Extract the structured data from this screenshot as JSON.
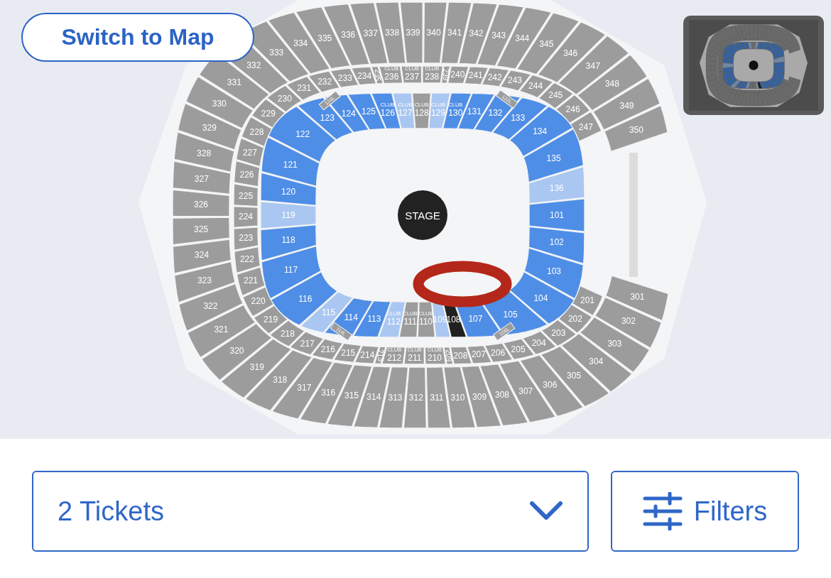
{
  "map_toggle": {
    "label": "Switch to Map"
  },
  "stage": {
    "label": "STAGE"
  },
  "map": {
    "upper_level": {
      "top": [
        {
          "label": "333",
          "color": "#9c9c9c"
        },
        {
          "label": "334",
          "color": "#9c9c9c"
        },
        {
          "label": "335",
          "color": "#9c9c9c"
        },
        {
          "label": "336",
          "color": "#9c9c9c"
        },
        {
          "label": "337",
          "color": "#9c9c9c"
        },
        {
          "label": "338",
          "color": "#9c9c9c"
        },
        {
          "label": "339",
          "color": "#9c9c9c"
        },
        {
          "label": "340",
          "color": "#9c9c9c"
        },
        {
          "label": "341",
          "color": "#9c9c9c"
        },
        {
          "label": "342",
          "color": "#9c9c9c"
        },
        {
          "label": "343",
          "color": "#9c9c9c"
        },
        {
          "label": "344",
          "color": "#9c9c9c"
        },
        {
          "label": "345",
          "color": "#9c9c9c"
        },
        {
          "label": "346",
          "color": "#9c9c9c"
        }
      ],
      "left": [
        {
          "label": "332",
          "color": "#9c9c9c"
        },
        {
          "label": "331",
          "color": "#9c9c9c"
        },
        {
          "label": "330",
          "color": "#9c9c9c"
        },
        {
          "label": "329",
          "color": "#9c9c9c"
        },
        {
          "label": "328",
          "color": "#9c9c9c"
        },
        {
          "label": "327",
          "color": "#9c9c9c"
        },
        {
          "label": "326",
          "color": "#9c9c9c"
        },
        {
          "label": "325",
          "color": "#9c9c9c"
        },
        {
          "label": "324",
          "color": "#9c9c9c"
        },
        {
          "label": "323",
          "color": "#9c9c9c"
        },
        {
          "label": "322",
          "color": "#9c9c9c"
        },
        {
          "label": "321",
          "color": "#9c9c9c"
        },
        {
          "label": "320",
          "color": "#9c9c9c"
        },
        {
          "label": "319",
          "color": "#9c9c9c"
        }
      ],
      "right": [
        {
          "label": "347",
          "color": "#9c9c9c"
        },
        {
          "label": "348",
          "color": "#9c9c9c"
        },
        {
          "label": "349",
          "color": "#9c9c9c"
        },
        {
          "label": "350",
          "color": "#9c9c9c"
        },
        {
          "label": "301",
          "color": "#9c9c9c"
        },
        {
          "label": "302",
          "color": "#9c9c9c"
        },
        {
          "label": "303",
          "color": "#9c9c9c"
        },
        {
          "label": "304",
          "color": "#9c9c9c"
        }
      ],
      "bottom": [
        {
          "label": "318",
          "color": "#9c9c9c"
        },
        {
          "label": "317",
          "color": "#9c9c9c"
        },
        {
          "label": "316",
          "color": "#9c9c9c"
        },
        {
          "label": "315",
          "color": "#9c9c9c"
        },
        {
          "label": "314",
          "color": "#9c9c9c"
        },
        {
          "label": "313",
          "color": "#9c9c9c"
        },
        {
          "label": "312",
          "color": "#9c9c9c"
        },
        {
          "label": "311",
          "color": "#9c9c9c"
        },
        {
          "label": "310",
          "color": "#9c9c9c"
        },
        {
          "label": "309",
          "color": "#9c9c9c"
        },
        {
          "label": "308",
          "color": "#9c9c9c"
        },
        {
          "label": "307",
          "color": "#9c9c9c"
        },
        {
          "label": "306",
          "color": "#9c9c9c"
        },
        {
          "label": "305",
          "color": "#9c9c9c"
        }
      ]
    },
    "club_level": {
      "top": [
        {
          "label": "231",
          "kind": "standard",
          "color": "#9c9c9c"
        },
        {
          "label": "232",
          "kind": "standard",
          "color": "#9c9c9c"
        },
        {
          "label": "233",
          "kind": "standard",
          "color": "#9c9c9c"
        },
        {
          "label": "234",
          "kind": "standard",
          "color": "#9c9c9c"
        },
        {
          "label": "235",
          "kind": "narrow",
          "color": "#9c9c9c"
        },
        {
          "label": "236",
          "kind": "club",
          "tag": "CLUB",
          "color": "#9c9c9c"
        },
        {
          "label": "237",
          "kind": "club",
          "tag": "CLUB",
          "color": "#9c9c9c"
        },
        {
          "label": "238",
          "kind": "club",
          "tag": "CLUB",
          "color": "#9c9c9c"
        },
        {
          "label": "239",
          "kind": "narrow",
          "color": "#9c9c9c"
        },
        {
          "label": "240",
          "kind": "standard",
          "color": "#9c9c9c"
        },
        {
          "label": "241",
          "kind": "standard",
          "color": "#9c9c9c"
        },
        {
          "label": "242",
          "kind": "standard",
          "color": "#9c9c9c"
        },
        {
          "label": "243",
          "kind": "standard",
          "color": "#9c9c9c"
        },
        {
          "label": "244",
          "kind": "standard",
          "color": "#9c9c9c"
        }
      ],
      "left": [
        {
          "label": "230",
          "kind": "standard",
          "color": "#9c9c9c"
        },
        {
          "label": "229",
          "kind": "standard",
          "color": "#9c9c9c"
        },
        {
          "label": "228",
          "kind": "standard",
          "color": "#9c9c9c"
        },
        {
          "label": "227",
          "kind": "standard",
          "color": "#9c9c9c"
        },
        {
          "label": "226",
          "kind": "standard",
          "color": "#9c9c9c"
        },
        {
          "label": "225",
          "kind": "standard",
          "color": "#9c9c9c"
        },
        {
          "label": "224",
          "kind": "standard",
          "color": "#9c9c9c"
        },
        {
          "label": "223",
          "kind": "standard",
          "color": "#9c9c9c"
        },
        {
          "label": "222",
          "kind": "standard",
          "color": "#9c9c9c"
        },
        {
          "label": "221",
          "kind": "standard",
          "color": "#9c9c9c"
        },
        {
          "label": "220",
          "kind": "standard",
          "color": "#9c9c9c"
        },
        {
          "label": "219",
          "kind": "standard",
          "color": "#9c9c9c"
        },
        {
          "label": "218",
          "kind": "standard",
          "color": "#9c9c9c"
        }
      ],
      "right": [
        {
          "label": "245",
          "kind": "standard",
          "color": "#9c9c9c"
        },
        {
          "label": "246",
          "kind": "standard",
          "color": "#9c9c9c"
        },
        {
          "label": "247",
          "kind": "standard",
          "color": "#9c9c9c"
        },
        {
          "label": "201",
          "kind": "standard",
          "color": "#9c9c9c"
        },
        {
          "label": "202",
          "kind": "standard",
          "color": "#9c9c9c"
        },
        {
          "label": "203",
          "kind": "standard",
          "color": "#9c9c9c"
        }
      ],
      "bottom": [
        {
          "label": "217",
          "kind": "standard",
          "color": "#9c9c9c"
        },
        {
          "label": "216",
          "kind": "standard",
          "color": "#9c9c9c"
        },
        {
          "label": "215",
          "kind": "standard",
          "color": "#9c9c9c"
        },
        {
          "label": "214",
          "kind": "standard",
          "color": "#9c9c9c"
        },
        {
          "label": "213",
          "kind": "narrow",
          "color": "#9c9c9c"
        },
        {
          "label": "212",
          "kind": "club",
          "tag": "CLUB",
          "color": "#9c9c9c"
        },
        {
          "label": "211",
          "kind": "club",
          "tag": "CLUB",
          "color": "#9c9c9c"
        },
        {
          "label": "210",
          "kind": "club",
          "tag": "CLUB",
          "color": "#9c9c9c"
        },
        {
          "label": "209",
          "kind": "narrow",
          "color": "#9c9c9c"
        },
        {
          "label": "208",
          "kind": "standard",
          "color": "#9c9c9c"
        },
        {
          "label": "207",
          "kind": "standard",
          "color": "#9c9c9c"
        },
        {
          "label": "206",
          "kind": "standard",
          "color": "#9c9c9c"
        },
        {
          "label": "205",
          "kind": "standard",
          "color": "#9c9c9c"
        },
        {
          "label": "204",
          "kind": "standard",
          "color": "#9c9c9c"
        }
      ]
    },
    "lower_level": {
      "top": [
        {
          "label": "123",
          "kind": "standard",
          "color": "#4f8ee6"
        },
        {
          "label": "124",
          "kind": "standard",
          "color": "#4f8ee6"
        },
        {
          "label": "125",
          "kind": "standard",
          "color": "#4f8ee6"
        },
        {
          "label": "126",
          "kind": "club",
          "tag": "CLUB",
          "color": "#4f8ee6"
        },
        {
          "label": "127",
          "kind": "club",
          "tag": "CLUB",
          "color": "#a9c7f1"
        },
        {
          "label": "128",
          "kind": "club",
          "tag": "CLUB",
          "color": "#9c9c9c"
        },
        {
          "label": "129",
          "kind": "club",
          "tag": "CLUB",
          "color": "#a9c7f1"
        },
        {
          "label": "130",
          "kind": "club",
          "tag": "CLUB",
          "color": "#4f8ee6"
        },
        {
          "label": "131",
          "kind": "standard",
          "color": "#4f8ee6"
        },
        {
          "label": "132",
          "kind": "standard",
          "color": "#4f8ee6"
        },
        {
          "label": "133",
          "kind": "standard",
          "color": "#4f8ee6"
        },
        {
          "label": "134",
          "kind": "standard",
          "color": "#4f8ee6"
        }
      ],
      "left": [
        {
          "label": "122",
          "kind": "standard",
          "color": "#4f8ee6"
        },
        {
          "label": "121",
          "kind": "standard",
          "color": "#4f8ee6"
        },
        {
          "label": "120",
          "kind": "standard",
          "color": "#4f8ee6"
        },
        {
          "label": "119",
          "kind": "standard",
          "color": "#a9c7f1"
        },
        {
          "label": "118",
          "kind": "standard",
          "color": "#4f8ee6"
        },
        {
          "label": "117",
          "kind": "standard",
          "color": "#4f8ee6"
        },
        {
          "label": "116",
          "kind": "standard",
          "color": "#4f8ee6"
        }
      ],
      "right": [
        {
          "label": "135",
          "kind": "standard",
          "color": "#4f8ee6"
        },
        {
          "label": "136",
          "kind": "standard",
          "color": "#a9c7f1"
        },
        {
          "label": "101",
          "kind": "standard",
          "color": "#4f8ee6"
        },
        {
          "label": "102",
          "kind": "standard",
          "color": "#4f8ee6"
        },
        {
          "label": "103",
          "kind": "standard",
          "color": "#4f8ee6"
        },
        {
          "label": "104",
          "kind": "standard",
          "color": "#4f8ee6"
        }
      ],
      "bottom": [
        {
          "label": "115",
          "kind": "standard",
          "color": "#a9c7f1"
        },
        {
          "label": "114",
          "kind": "standard",
          "color": "#4f8ee6"
        },
        {
          "label": "113",
          "kind": "standard",
          "color": "#4f8ee6"
        },
        {
          "label": "112",
          "kind": "club",
          "tag": "CLUB",
          "color": "#a9c7f1"
        },
        {
          "label": "111",
          "kind": "club",
          "tag": "CLUB",
          "color": "#9c9c9c"
        },
        {
          "label": "110",
          "kind": "club",
          "tag": "CLUB",
          "color": "#9c9c9c"
        },
        {
          "label": "109",
          "kind": "standard",
          "color": "#a9c7f1"
        },
        {
          "label": "108",
          "kind": "standard",
          "color": "#202020"
        },
        {
          "label": "107",
          "kind": "standard",
          "color": "#4f8ee6"
        },
        {
          "label": "105",
          "kind": "standard",
          "color": "#4f8ee6"
        }
      ]
    },
    "loges": [
      {
        "label": "124L",
        "color": "#9c9c9c"
      },
      {
        "label": "132L",
        "color": "#9c9c9c"
      },
      {
        "label": "114L",
        "color": "#9c9c9c"
      },
      {
        "label": "106L",
        "color": "#9c9c9c"
      }
    ]
  },
  "annotation": {
    "kind": "ring"
  },
  "ticket_select": {
    "value": "2 Tickets"
  },
  "filters_button": {
    "label": "Filters"
  }
}
